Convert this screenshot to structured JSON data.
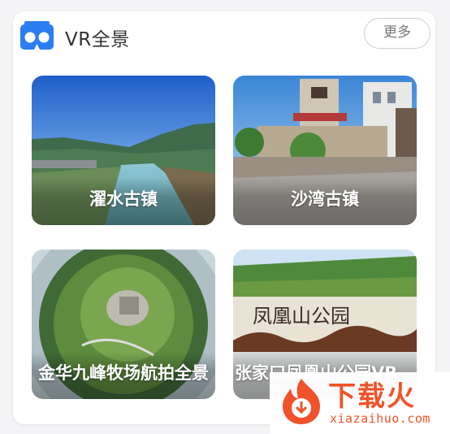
{
  "section": {
    "title": "VR全景",
    "more_label": "更多",
    "icon": "vr-headset-icon"
  },
  "tiles": [
    {
      "label": "濯水古镇"
    },
    {
      "label": "沙湾古镇"
    },
    {
      "label": "金华九峰牧场航拍全景"
    },
    {
      "label": "张家口凤凰山公园VR"
    }
  ],
  "scene_text": {
    "park_sign": "凤凰山公园"
  },
  "watermark": {
    "name": "下载火",
    "domain": "xiazaihuo.com"
  },
  "colors": {
    "accent_blue": "#2b7ef2",
    "watermark_orange": "#f0532a"
  }
}
